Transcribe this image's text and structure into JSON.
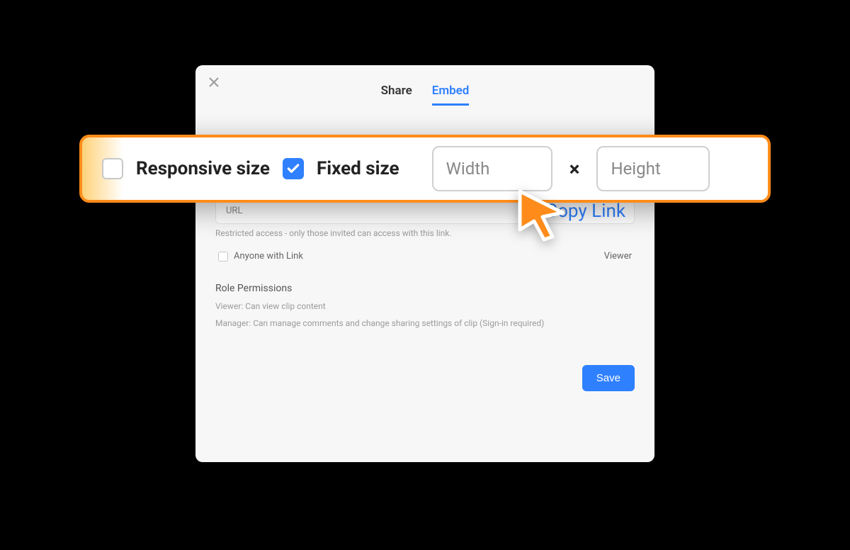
{
  "tabs": {
    "share": "Share",
    "embed": "Embed"
  },
  "highlight": {
    "responsive_label": "Responsive size",
    "fixed_label": "Fixed size",
    "width_placeholder": "Width",
    "height_placeholder": "Height",
    "multiply": "×"
  },
  "url": {
    "label": "URL",
    "copy_link": "Copy Link",
    "restricted": "Restricted access - only those invited can access with this link."
  },
  "anyone": {
    "label": "Anyone with Link",
    "role": "Viewer"
  },
  "permissions": {
    "title": "Role Permissions",
    "viewer": "Viewer: Can view clip content",
    "manager": "Manager: Can manage comments and change sharing settings of clip (Sign-in required)"
  },
  "save_label": "Save"
}
